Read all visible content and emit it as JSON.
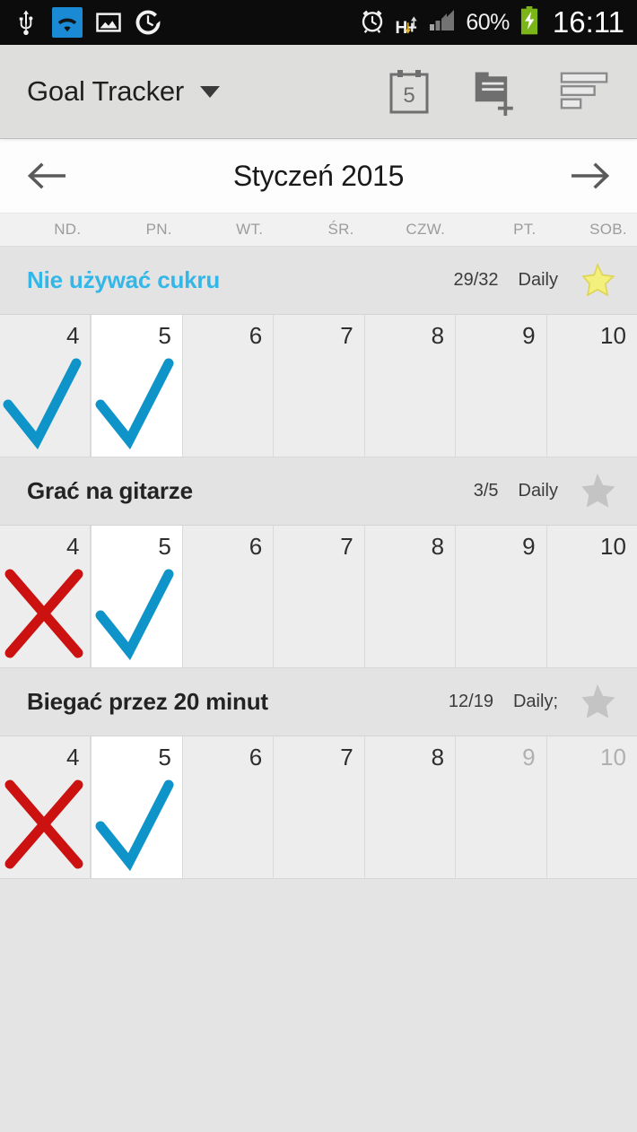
{
  "status_bar": {
    "icons": [
      "usb-icon",
      "wifi-icon",
      "gallery-icon",
      "clock-icon",
      "alarm-icon"
    ],
    "network_type": "H+",
    "battery_percent": "60%",
    "time": "16:11",
    "background": "#0c0c0c",
    "wifi_highlight": "#1a8ad4",
    "battery_color": "#7cb518"
  },
  "app_bar": {
    "title": "Goal Tracker",
    "dropdown_icon": "chevron-down-icon",
    "actions": [
      {
        "name": "calendar-icon",
        "label": "5"
      },
      {
        "name": "add-note-icon",
        "label": ""
      },
      {
        "name": "sort-list-icon",
        "label": ""
      }
    ],
    "background": "#dededd"
  },
  "month_nav": {
    "prev_icon": "arrow-left-icon",
    "next_icon": "arrow-right-icon",
    "title": "Styczeń 2015"
  },
  "weekdays": [
    "ND.",
    "PN.",
    "WT.",
    "ŚR.",
    "CZW.",
    "PT.",
    "SOB."
  ],
  "colors": {
    "check": "#0e94c9",
    "cross": "#cc1111",
    "star_on": "#f4f07e",
    "star_off": "#c4c4c4",
    "goal_highlight": "#33b6e8"
  },
  "goals": [
    {
      "name": "Nie używać cukru",
      "highlighted": true,
      "count": "29/32",
      "frequency": "Daily",
      "star": "star-filled-icon",
      "starred": true,
      "days": [
        {
          "num": "4",
          "mark": "check",
          "today": false,
          "dim": false
        },
        {
          "num": "5",
          "mark": "check",
          "today": true,
          "dim": false
        },
        {
          "num": "6",
          "mark": "none",
          "today": false,
          "dim": false
        },
        {
          "num": "7",
          "mark": "none",
          "today": false,
          "dim": false
        },
        {
          "num": "8",
          "mark": "none",
          "today": false,
          "dim": false
        },
        {
          "num": "9",
          "mark": "none",
          "today": false,
          "dim": false
        },
        {
          "num": "10",
          "mark": "none",
          "today": false,
          "dim": false
        }
      ]
    },
    {
      "name": "Grać na gitarze",
      "highlighted": false,
      "count": "3/5",
      "frequency": "Daily",
      "star": "star-outline-icon",
      "starred": false,
      "days": [
        {
          "num": "4",
          "mark": "cross",
          "today": false,
          "dim": false
        },
        {
          "num": "5",
          "mark": "check",
          "today": true,
          "dim": false
        },
        {
          "num": "6",
          "mark": "none",
          "today": false,
          "dim": false
        },
        {
          "num": "7",
          "mark": "none",
          "today": false,
          "dim": false
        },
        {
          "num": "8",
          "mark": "none",
          "today": false,
          "dim": false
        },
        {
          "num": "9",
          "mark": "none",
          "today": false,
          "dim": false
        },
        {
          "num": "10",
          "mark": "none",
          "today": false,
          "dim": false
        }
      ]
    },
    {
      "name": "Biegać przez 20 minut",
      "highlighted": false,
      "count": "12/19",
      "frequency": "Daily;",
      "star": "star-outline-icon",
      "starred": false,
      "days": [
        {
          "num": "4",
          "mark": "cross",
          "today": false,
          "dim": false
        },
        {
          "num": "5",
          "mark": "check",
          "today": true,
          "dim": false
        },
        {
          "num": "6",
          "mark": "none",
          "today": false,
          "dim": false
        },
        {
          "num": "7",
          "mark": "none",
          "today": false,
          "dim": false
        },
        {
          "num": "8",
          "mark": "none",
          "today": false,
          "dim": false
        },
        {
          "num": "9",
          "mark": "none",
          "today": false,
          "dim": true
        },
        {
          "num": "10",
          "mark": "none",
          "today": false,
          "dim": true
        }
      ]
    }
  ]
}
